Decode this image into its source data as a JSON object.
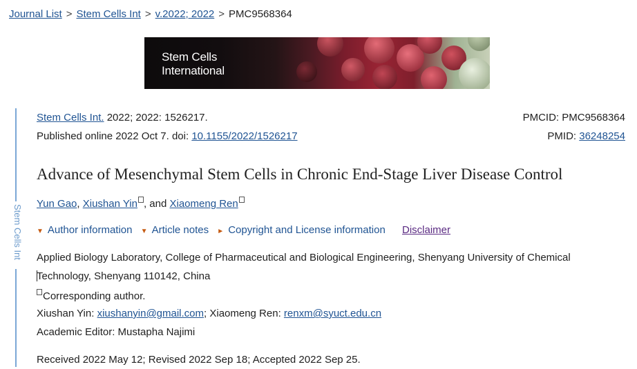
{
  "breadcrumb": {
    "journal_list": "Journal List",
    "journal": "Stem Cells Int",
    "volume": "v.2022; 2022",
    "current": "PMC9568364",
    "separator": ">"
  },
  "banner": {
    "line1": "Stem Cells",
    "line2": "International"
  },
  "sidebar": {
    "label": "Stem Cells Int"
  },
  "citation": {
    "journal_link": "Stem Cells Int.",
    "journal_rest": " 2022; 2022: 1526217.",
    "published_prefix": "Published online 2022 Oct 7. doi: ",
    "doi": "10.1155/2022/1526217",
    "pmcid": "PMCID: PMC9568364",
    "pmid_label": "PMID: ",
    "pmid": "36248254"
  },
  "article": {
    "title": "Advance of Mesenchymal Stem Cells in Chronic End-Stage Liver Disease Control"
  },
  "authors": {
    "author1": "Yun Gao",
    "comma1": ", ",
    "author2": "Xiushan Yin",
    "comma2": ", and ",
    "author3": "Xiaomeng Ren"
  },
  "toggles": {
    "author_info": "Author information",
    "article_notes": "Article notes",
    "copyright": "Copyright and License information",
    "disclaimer": "Disclaimer"
  },
  "affiliation": {
    "line1": "Applied Biology Laboratory, College of Pharmaceutical and Biological Engineering, Shenyang University of Chemical",
    "line2": "Technology, Shenyang 110142, China",
    "corresponding": "Corresponding author.",
    "contact_name1": "Xiushan Yin: ",
    "email1": "xiushanyin@gmail.com",
    "contact_name2": "; Xiaomeng Ren: ",
    "email2": "renxm@syuct.edu.cn",
    "editor": "Academic Editor: Mustapha Najimi"
  },
  "dates": {
    "history": "Received 2022 May 12; Revised 2022 Sep 18; Accepted 2022 Sep 25."
  },
  "colors": {
    "link": "#205493",
    "visited_link": "#5a2a82",
    "toggle_arrow": "#c55a11",
    "sidebar": "#7aa7d6"
  }
}
